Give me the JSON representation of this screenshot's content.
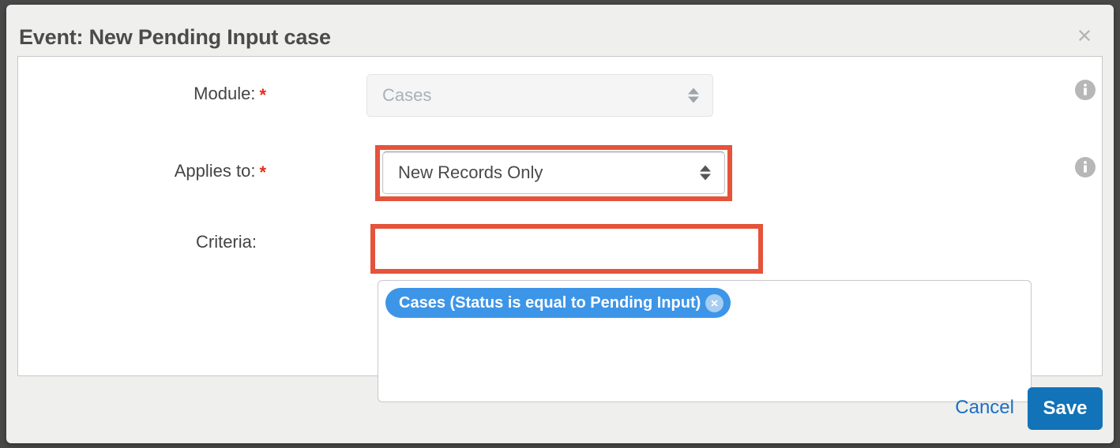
{
  "dialog": {
    "title": "Event: New Pending Input case",
    "close_icon": "close-x-icon"
  },
  "fields": {
    "module": {
      "label": "Module:",
      "required_marker": "*",
      "value": "Cases",
      "disabled": true,
      "info_icon": "info-icon"
    },
    "applies_to": {
      "label": "Applies to:",
      "required_marker": "*",
      "value": "New Records Only",
      "disabled": false,
      "info_icon": "info-icon"
    },
    "criteria": {
      "label": "Criteria:",
      "pills": [
        {
          "text": "Cases (Status is equal to Pending Input)",
          "remove_icon": "remove-circle-x-icon"
        }
      ]
    }
  },
  "footer": {
    "cancel_label": "Cancel",
    "save_label": "Save"
  },
  "colors": {
    "annotation": "#e4533a",
    "pill": "#3d95e8",
    "save": "#1273b8",
    "cancel_link": "#1b6fc4",
    "required": "#e62c18"
  }
}
